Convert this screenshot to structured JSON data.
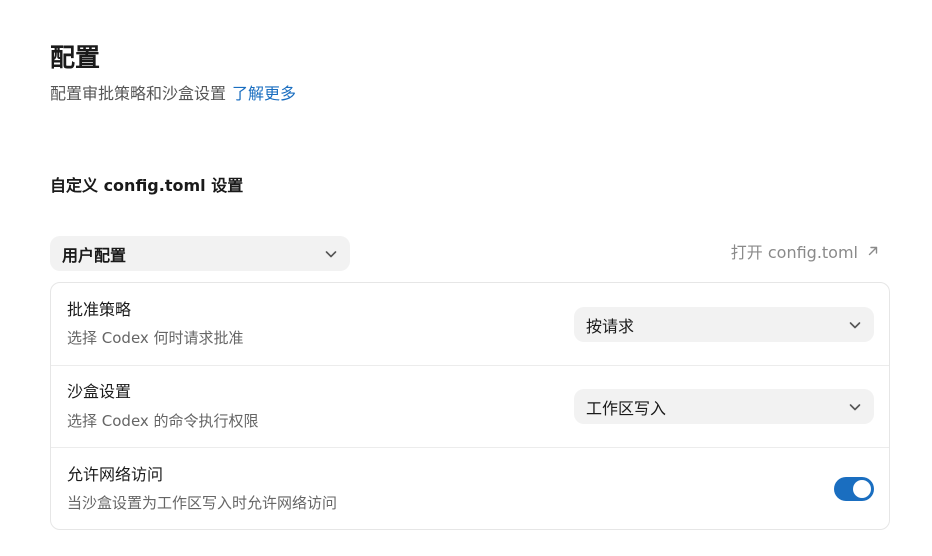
{
  "header": {
    "title": "配置",
    "subtitle": "配置审批策略和沙盒设置",
    "learn_more": "了解更多"
  },
  "section": {
    "title": "自定义 config.toml 设置"
  },
  "profile": {
    "selected": "用户配置",
    "open_config_label": "打开 config.toml"
  },
  "settings": {
    "approval": {
      "title": "批准策略",
      "description": "选择 Codex 何时请求批准",
      "value": "按请求"
    },
    "sandbox": {
      "title": "沙盒设置",
      "description": "选择 Codex 的命令执行权限",
      "value": "工作区写入"
    },
    "network": {
      "title": "允许网络访问",
      "description": "当沙盒设置为工作区写入时允许网络访问",
      "enabled": true
    }
  },
  "colors": {
    "accent": "#1a6ec0",
    "control_bg": "#f2f2f2",
    "border": "#e6e6e6"
  },
  "icons": {
    "dropdown": "chevron-down-icon",
    "external": "arrow-up-right-icon"
  }
}
